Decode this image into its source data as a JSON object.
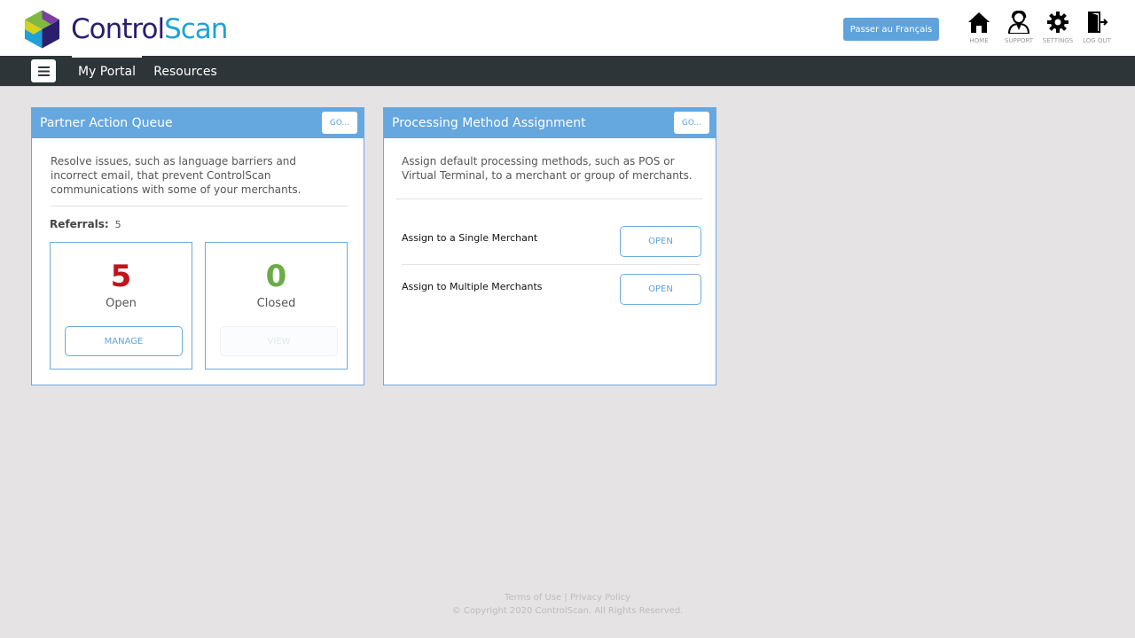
{
  "header": {
    "brand_part1": "Control",
    "brand_part2": "Scan",
    "language_button": "Passer au Français",
    "icons": [
      {
        "name": "home-icon",
        "label": "HOME"
      },
      {
        "name": "support-icon",
        "label": "SUPPORT"
      },
      {
        "name": "settings-icon",
        "label": "SETTINGS"
      },
      {
        "name": "logout-icon",
        "label": "LOG OUT"
      }
    ]
  },
  "nav": {
    "menu_icon": "hamburger-icon",
    "tabs": [
      {
        "label": "My Portal",
        "active": true
      },
      {
        "label": "Resources",
        "active": false
      }
    ]
  },
  "partner_queue": {
    "title": "Partner Action Queue",
    "go_label": "GO...",
    "description": "Resolve issues, such as language barriers and incorrect email, that prevent ControlScan communications with some of your merchants.",
    "referrals_label": "Referrals:",
    "referrals_count": "5",
    "open": {
      "count": "5",
      "label": "Open",
      "button": "MANAGE",
      "color": "#c0141c"
    },
    "closed": {
      "count": "0",
      "label": "Closed",
      "button": "VIEW",
      "color": "#6aac46"
    }
  },
  "processing": {
    "title": "Processing Method Assignment",
    "go_label": "GO...",
    "description": "Assign default processing methods, such as POS or Virtual Terminal, to a merchant or group of merchants.",
    "rows": [
      {
        "label": "Assign to a Single Merchant",
        "button": "OPEN"
      },
      {
        "label": "Assign to Multiple Merchants",
        "button": "OPEN"
      }
    ]
  },
  "footer": {
    "terms": "Terms of Use",
    "separator": "|",
    "privacy": "Privacy Policy",
    "copyright": "© Copyright 2020 ControlScan. All Rights Reserved."
  },
  "colors": {
    "accent": "#65a7df",
    "nav_bg": "#2d3538",
    "page_bg": "#e5e3e4"
  }
}
